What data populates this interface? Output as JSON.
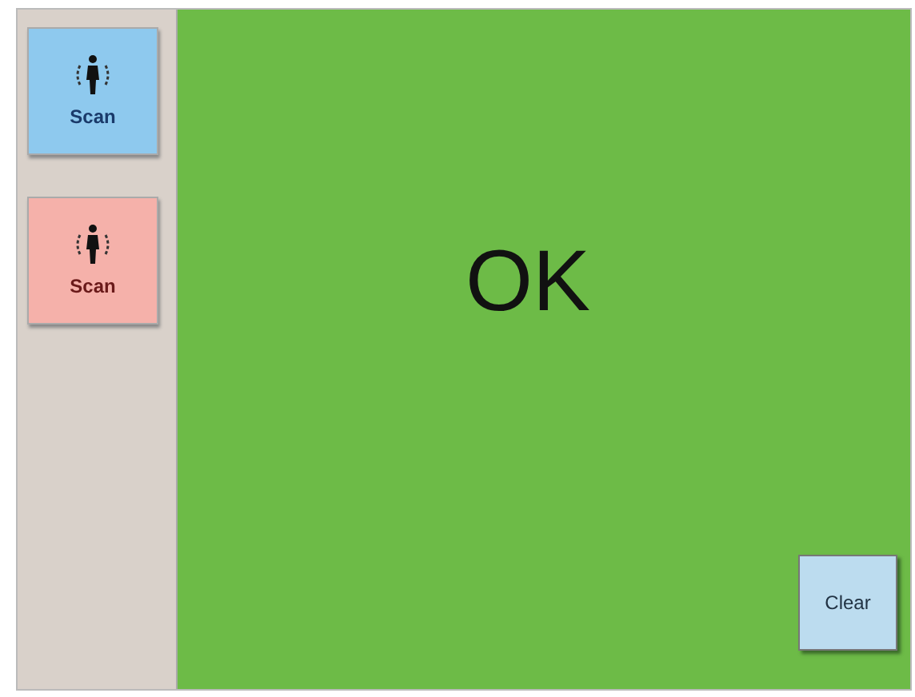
{
  "scan_buttons": [
    {
      "label": "Scan",
      "color": "#8ec9ee"
    },
    {
      "label": "Scan",
      "color": "#f5b1aa"
    }
  ],
  "status": "OK",
  "buttons": [
    {
      "label": "Clear"
    }
  ]
}
